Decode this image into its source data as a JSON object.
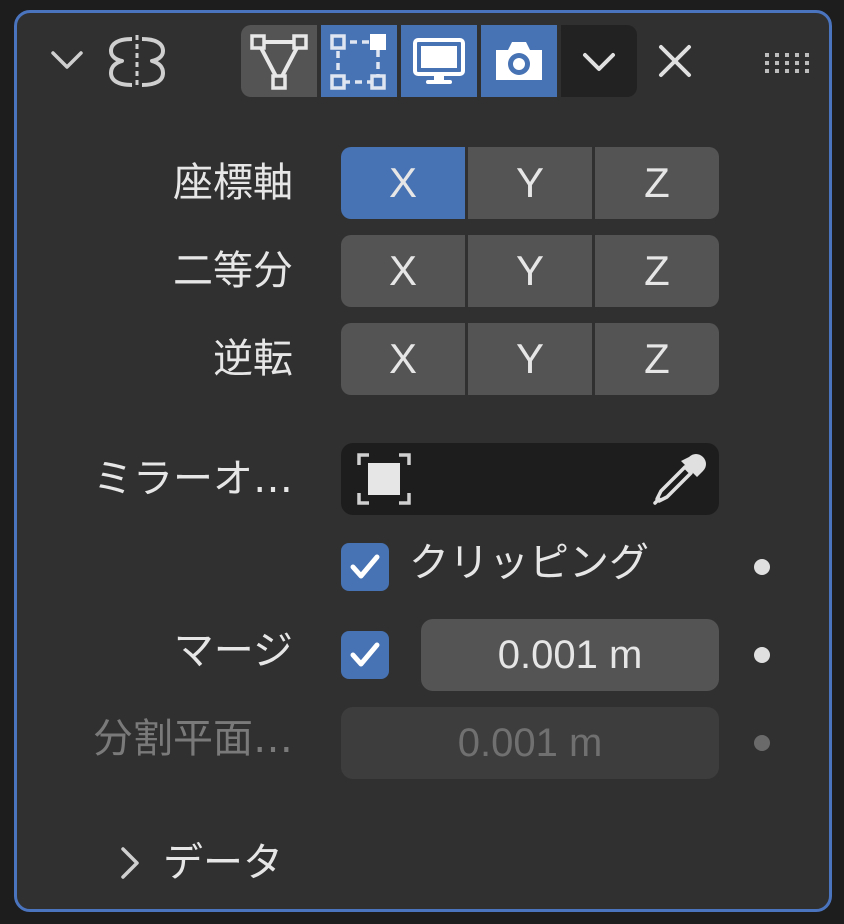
{
  "header": {
    "collapse_icon": "chevron-down-icon",
    "modifier_icon": "mirror-modifier-icon",
    "toggles": [
      {
        "name": "edit-mode-cage",
        "icon": "vertex-triangle-icon",
        "active": false
      },
      {
        "name": "edit-mode",
        "icon": "edit-mode-square-icon",
        "active": true
      },
      {
        "name": "viewport",
        "icon": "monitor-icon",
        "active": true
      },
      {
        "name": "render",
        "icon": "camera-icon",
        "active": true
      }
    ],
    "dropdown_icon": "chevron-down-icon",
    "close_icon": "close-icon",
    "grip_icon": "drag-grip-icon"
  },
  "rows": {
    "axis": {
      "label": "座標軸",
      "buttons": [
        "X",
        "Y",
        "Z"
      ],
      "active": 0
    },
    "bisect": {
      "label": "二等分",
      "buttons": [
        "X",
        "Y",
        "Z"
      ],
      "active": -1
    },
    "flip": {
      "label": "逆転",
      "buttons": [
        "X",
        "Y",
        "Z"
      ],
      "active": -1
    }
  },
  "mirror_object": {
    "label": "ミラーオ…",
    "value": "",
    "eyedropper_icon": "eyedropper-icon"
  },
  "clipping": {
    "label": "クリッピング",
    "checked": true
  },
  "merge": {
    "label": "マージ",
    "checked": true,
    "value": "0.001 m"
  },
  "bisect_distance": {
    "label": "分割平面…",
    "value": "0.001 m",
    "enabled": false
  },
  "data_section": {
    "label": "データ",
    "expanded": false
  },
  "colors": {
    "accent": "#4772b3",
    "panel": "#303030",
    "border": "#4b74bf",
    "button": "#545454"
  }
}
